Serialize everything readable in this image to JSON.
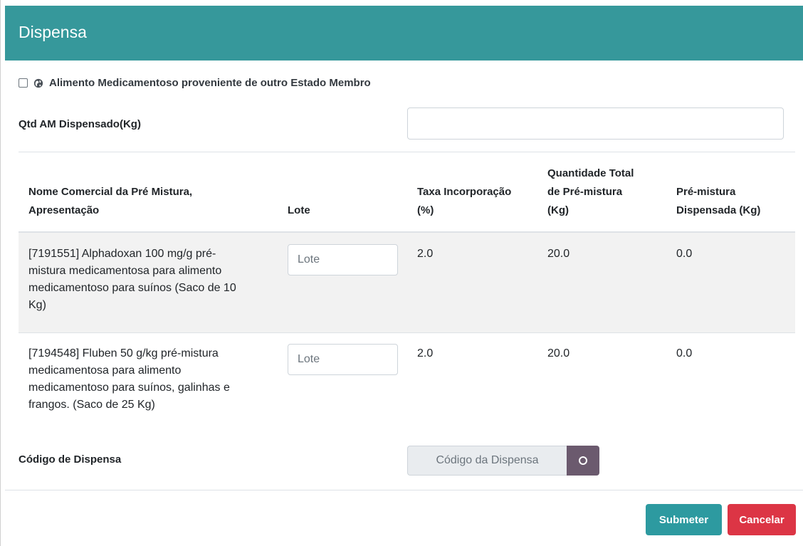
{
  "modal": {
    "title": "Dispensa"
  },
  "checkbox": {
    "label": "Alimento Medicamentoso proveniente de outro Estado Membro",
    "checked": false
  },
  "qtd": {
    "label": "Qtd AM Dispensado(Kg)",
    "value": ""
  },
  "table": {
    "headers": {
      "nome_line1": "Nome Comercial da Pré Mistura,",
      "nome_line2": "Apresentação",
      "lote": "Lote",
      "taxa_line1": "Taxa Incorporação",
      "taxa_line2": "(%)",
      "qtd_line1": "Quantidade Total",
      "qtd_line2": "de Pré-mistura",
      "qtd_line3": "(Kg)",
      "pre_line1": "Pré-mistura",
      "pre_line2": "Dispensada (Kg)"
    },
    "rows": [
      {
        "nome_lines": [
          "[7191551] Alphadoxan 100 mg/g pré-",
          "mistura medicamentosa para alimento",
          "medicamentoso para suínos (Saco de 10",
          "Kg)"
        ],
        "lote_placeholder": "Lote",
        "taxa": "2.0",
        "quantidade_total": "20.0",
        "dispensada": "0.0"
      },
      {
        "nome_lines": [
          "[7194548] Fluben 50 g/kg pré-mistura",
          "medicamentosa para alimento",
          "medicamentoso para suínos, galinhas e",
          "frangos. (Saco de 25 Kg)"
        ],
        "lote_placeholder": "Lote",
        "taxa": "2.0",
        "quantidade_total": "20.0",
        "dispensada": "0.0"
      }
    ]
  },
  "codigo": {
    "label": "Código de Dispensa",
    "placeholder": "Código da Dispensa",
    "button_icon": "circle-icon"
  },
  "footer": {
    "submit_label": "Submeter",
    "cancel_label": "Cancelar"
  },
  "colors": {
    "header": "#36989b",
    "submit": "#2d9aa0",
    "cancel": "#dc3545",
    "codigo_button": "#6b5a6e"
  }
}
